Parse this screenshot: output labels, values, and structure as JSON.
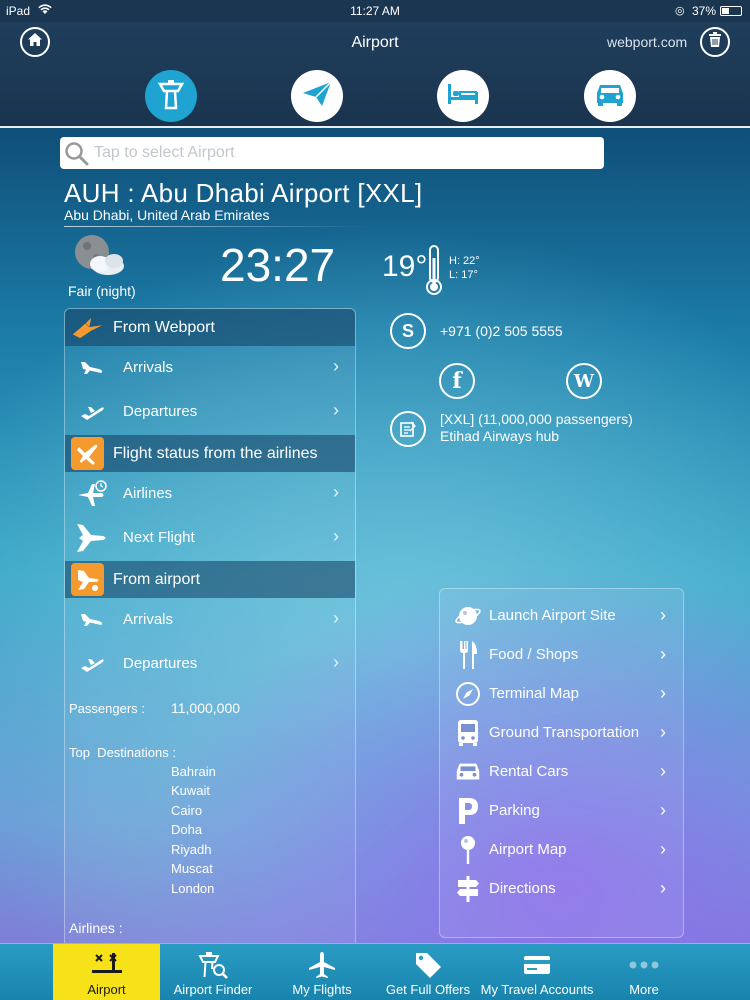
{
  "status_bar": {
    "carrier": "iPad",
    "time": "11:27 AM",
    "battery": "37%"
  },
  "nav": {
    "title": "Airport",
    "site": "webport.com",
    "modes": [
      "tower-icon",
      "plane-icon",
      "bed-icon",
      "car-icon"
    ],
    "active_mode": "tower-icon"
  },
  "search": {
    "placeholder": "Tap to select Airport",
    "value": ""
  },
  "airport": {
    "title": "AUH : Abu Dhabi Airport [XXL]",
    "subtitle": "Abu Dhabi, United Arab Emirates"
  },
  "weather": {
    "condition": "Fair (night)",
    "time": "23:27",
    "temp": "19°",
    "high": "H: 22°",
    "low": "L: 17°"
  },
  "left_panel": {
    "from_webport": {
      "header": "From Webport",
      "items": [
        {
          "label": "Arrivals",
          "icon": "arrival-plane-icon"
        },
        {
          "label": "Departures",
          "icon": "departure-plane-icon"
        }
      ]
    },
    "flight_status": {
      "header": "Flight status from the airlines",
      "items": [
        {
          "label": "Airlines",
          "icon": "airline-clock-icon"
        },
        {
          "label": "Next Flight",
          "icon": "next-flight-plane-icon"
        }
      ]
    },
    "from_airport": {
      "header": "From airport",
      "items": [
        {
          "label": "Arrivals",
          "icon": "arrival-plane-icon"
        },
        {
          "label": "Departures",
          "icon": "departure-plane-icon"
        }
      ]
    },
    "passengers_label": "Passengers :",
    "passengers_value": "11,000,000",
    "top_destinations_label": "Top  Destinations :",
    "top_destinations": [
      "Bahrain",
      "Kuwait",
      "Cairo",
      "Doha",
      "Riyadh",
      "Muscat",
      "London"
    ],
    "airlines_label": "Airlines :"
  },
  "contact": {
    "phone": "+971 (0)2 505 5555",
    "info_line1": "[XXL] (11,000,000 passengers)",
    "info_line2": "Etihad Airways hub"
  },
  "right_panel": {
    "items": [
      {
        "label": "Launch Airport Site",
        "icon": "globe-icon"
      },
      {
        "label": "Food / Shops",
        "icon": "fork-knife-icon"
      },
      {
        "label": "Terminal Map",
        "icon": "compass-icon"
      },
      {
        "label": "Ground Transportation",
        "icon": "bus-icon"
      },
      {
        "label": "Rental Cars",
        "icon": "car-icon"
      },
      {
        "label": "Parking",
        "icon": "parking-icon"
      },
      {
        "label": "Airport Map",
        "icon": "map-pin-icon"
      },
      {
        "label": "Directions",
        "icon": "signpost-icon"
      }
    ]
  },
  "tab_bar": {
    "active": "Airport",
    "tabs": [
      {
        "label": "Airport",
        "icon": "runway-icon"
      },
      {
        "label": "Airport Finder",
        "icon": "tower-search-icon"
      },
      {
        "label": "My Flights",
        "icon": "plane-icon"
      },
      {
        "label": "Get Full Offers",
        "icon": "tag-icon"
      },
      {
        "label": "My Travel Accounts",
        "icon": "credit-card-icon"
      },
      {
        "label": "More",
        "icon": "more-dots-icon"
      }
    ]
  },
  "colors": {
    "accent": "#1fa3d0",
    "orange": "#f59a2f",
    "tab_active": "#f7e21a",
    "nav_bg": "#1f3e5c"
  }
}
